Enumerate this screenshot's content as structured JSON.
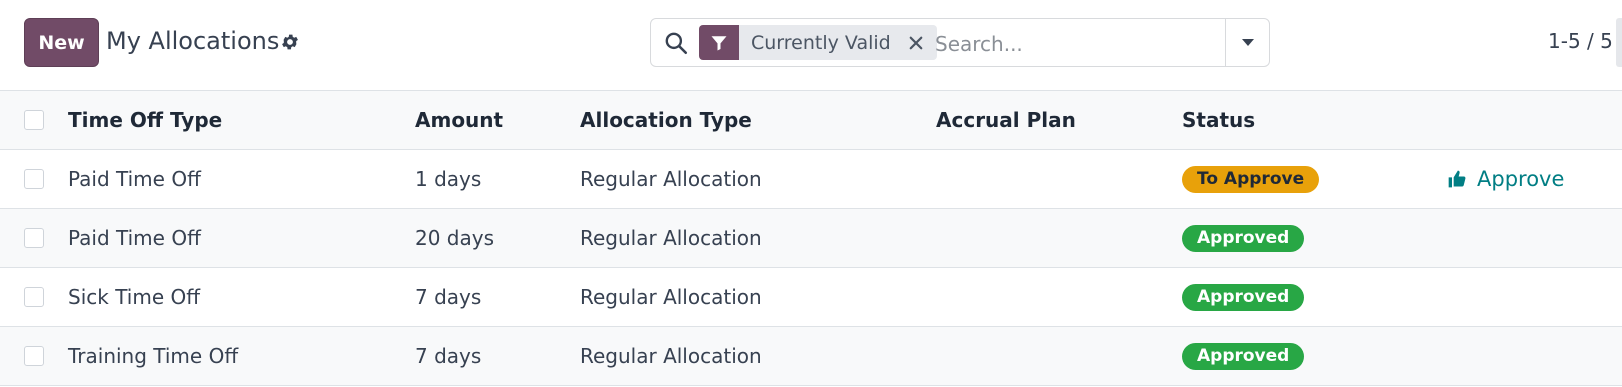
{
  "toolbar": {
    "new_label": "New",
    "title": "My Allocations",
    "settings_icon": "gear-icon"
  },
  "search": {
    "facet_icon": "filter-icon",
    "facet_label": "Currently Valid",
    "placeholder": "Search...",
    "value": ""
  },
  "pager": {
    "text": "1-5 / 5"
  },
  "table": {
    "headers": {
      "time_off_type": "Time Off Type",
      "amount": "Amount",
      "allocation_type": "Allocation Type",
      "accrual_plan": "Accrual Plan",
      "status": "Status"
    },
    "rows": [
      {
        "time_off_type": "Paid Time Off",
        "amount": "1 days",
        "allocation_type": "Regular Allocation",
        "accrual_plan": "",
        "status": "To Approve",
        "action": "Approve"
      },
      {
        "time_off_type": "Paid Time Off",
        "amount": "20 days",
        "allocation_type": "Regular Allocation",
        "accrual_plan": "",
        "status": "Approved",
        "action": ""
      },
      {
        "time_off_type": "Sick Time Off",
        "amount": "7 days",
        "allocation_type": "Regular Allocation",
        "accrual_plan": "",
        "status": "Approved",
        "action": ""
      },
      {
        "time_off_type": "Training Time Off",
        "amount": "7 days",
        "allocation_type": "Regular Allocation",
        "accrual_plan": "",
        "status": "Approved",
        "action": ""
      }
    ]
  },
  "colors": {
    "brand": "#714b67",
    "to_approve": "#e8a10a",
    "approved": "#28a745",
    "action": "#017e84"
  }
}
